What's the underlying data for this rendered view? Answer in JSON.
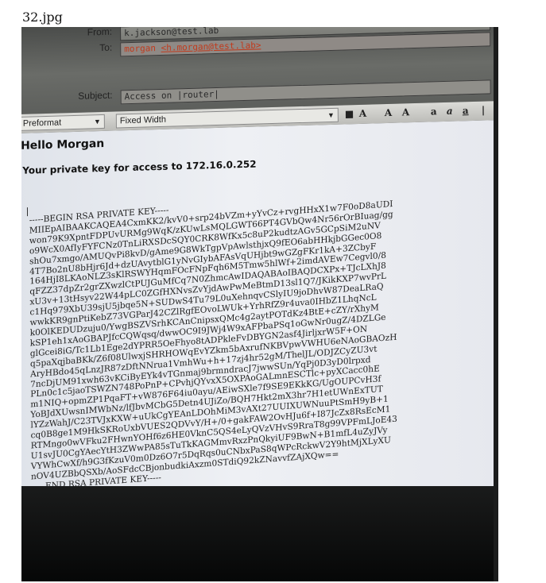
{
  "filename": "32.jpg",
  "mail": {
    "from_label": "From:",
    "from_value": "k.jackson@test.lab",
    "to_label": "To:",
    "to_value_name": "morgan",
    "to_value_addr": "<h.morgan@test.lab>",
    "subject_label": "Subject:",
    "subject_value": "Access on |router|"
  },
  "toolbar": {
    "format_select": "Preformat",
    "font_select": "Fixed Width"
  },
  "body": {
    "greeting": "Hello Morgan",
    "intro": "Your private key for access to 172.16.0.252",
    "cursor": "|",
    "key_lines": [
      "-----BEGIN RSA PRIVATE KEY-----",
      "MIIEpAIBAAKCAQEA4CxmKK2/kvV0+srp24bVZm+yYvCz+rvgHHxX1w7F0oD8aUDI",
      "won79K9XpntFDPUvURMg9WqK/zKUwLsMQLGWT66PT4GVbQw4Nr56rOrBIuag/gg",
      "o9WcX0AfIyFYFCNz0TnLiRXSDcSQY0CRK8WfKx5c8uP2kudtzAGv5GCpSiM2uNV",
      "shOu7xmgo/AMUQvPi8kvD/gAme9G8WkTgpVpAwlsthjxQ9fEO6abHHkjbGGec0O8",
      "4T7Bo2nU8bHjr6Jd+dzUAvytblG1yNvGIybAFAsVqUHjbt9wGZgFKr1kA+3ZCbyF",
      "164HjI8LKAoNLZ3sKlRSWYHqmFOcFNpFqh6M5Tmw5hlWf+2imdAVEw7Cegvl0/8",
      "qFZZ37dpZr2grZXwzlCtPUJGuMfCq7N0ZhmcAwIDAQABAoIBAQDCXPx+TJcLXhJ8",
      "xU3v+13tHsyv22W44pLC0ZGfHXNvsZvYjdAwPwMeBtmD13sl1Q7/JKikKXP7wvPrL",
      "c1Hq979XbU39sjU5jbqe5N+SUDwS4Tu79L0uXehnqvCSlyIU9joDhvW87DeaLRaQ",
      "wwkKR9gnPtiKebZ73VGParJ42CZlRgfEOvoLWUk+YrhRfZ9r4uva0IHbZ1LhqNcL",
      "k0OlKEDUDzuju0/YwgBSZVSrhKCAnCnipsxQMc4g2aytPOTdKz4BtE+cZY/rXhyM",
      "kSP1eh1xAoGBAPJfcCQWqsq/dwwOC9I9JWj4W9xAFPbaPSq1oGwNr0ugZ/4DZLGe",
      "glGcei8iG/Tc1Lb1Ege2dYPRR5OeFhyo8tADPkleFvDBYGN2asf4JirljxrW5F+ON",
      "q5paXqjbaBKk/Z6f08UlwxjSHRHOWqEvYZkm5bAxrufNKBVpwVWHU6eNAoGBAOzH",
      "AryHBdo45qLnzJR87zDftNNrua1VmhWu+h+17zj4hr52gM/ThelJL/ODJZCyZU3vt",
      "7ncDjUM91xwh63vKCiByEYk4vTGnmaj9brmndracJ7jwwSUn/YqPj0D3yD0lrpxd",
      "PLn0c1c5jaoTSWZN748PoPnP+CPvhjQYvxX5OXPAoGALmnESCTlc+pyXCacc0hE",
      "m1NIQ+opmZP1PqaFT+vW876F64iu0ayu/AEiwSXle7f9SE9EKkKG/UgOUPCvH3f",
      "YoBJdXUwsnIMWbNz/lfJbvMCbG5Detn4UJiZo/BQH7Hkt2mX3hr7H1etUWnExTUT",
      "lYZzWahJ/C23TVJxKXW+uUkCgYEAnLDOhMiM3vAXt27UUIXUWNuuPtSmH9yB+1",
      "cq0B8ge1M9HkSKRoUxbVUES2QDVvY/H+/0+gakFAW2OvHJu6f+I87JcZx8RsEcM1",
      "RTMngo0wVFku2FHwnYOHf6z6HE0VknC5QS4eLyQVzVHvS9RraT8g99VPFmLJoE43",
      "U1svJU0CgYAecYtH3ZWwPA85sTuTkKAGMmvRxzPnQkyiUF9BwN+B1mfL4uZyJVy",
      "VYWhCwXf/h9G3fKzuV0m0Dz6O7r5DqRqs0uCNbxPaS8qWPcRckwV2Y9htMjXLyXU",
      "nOV4UZBbQSXb/AoSFdcCBjonbudkiAxzm0STdiQ92kZNavvfZAjXQw==",
      "-----END RSA PRIVATE KEY-----"
    ]
  }
}
